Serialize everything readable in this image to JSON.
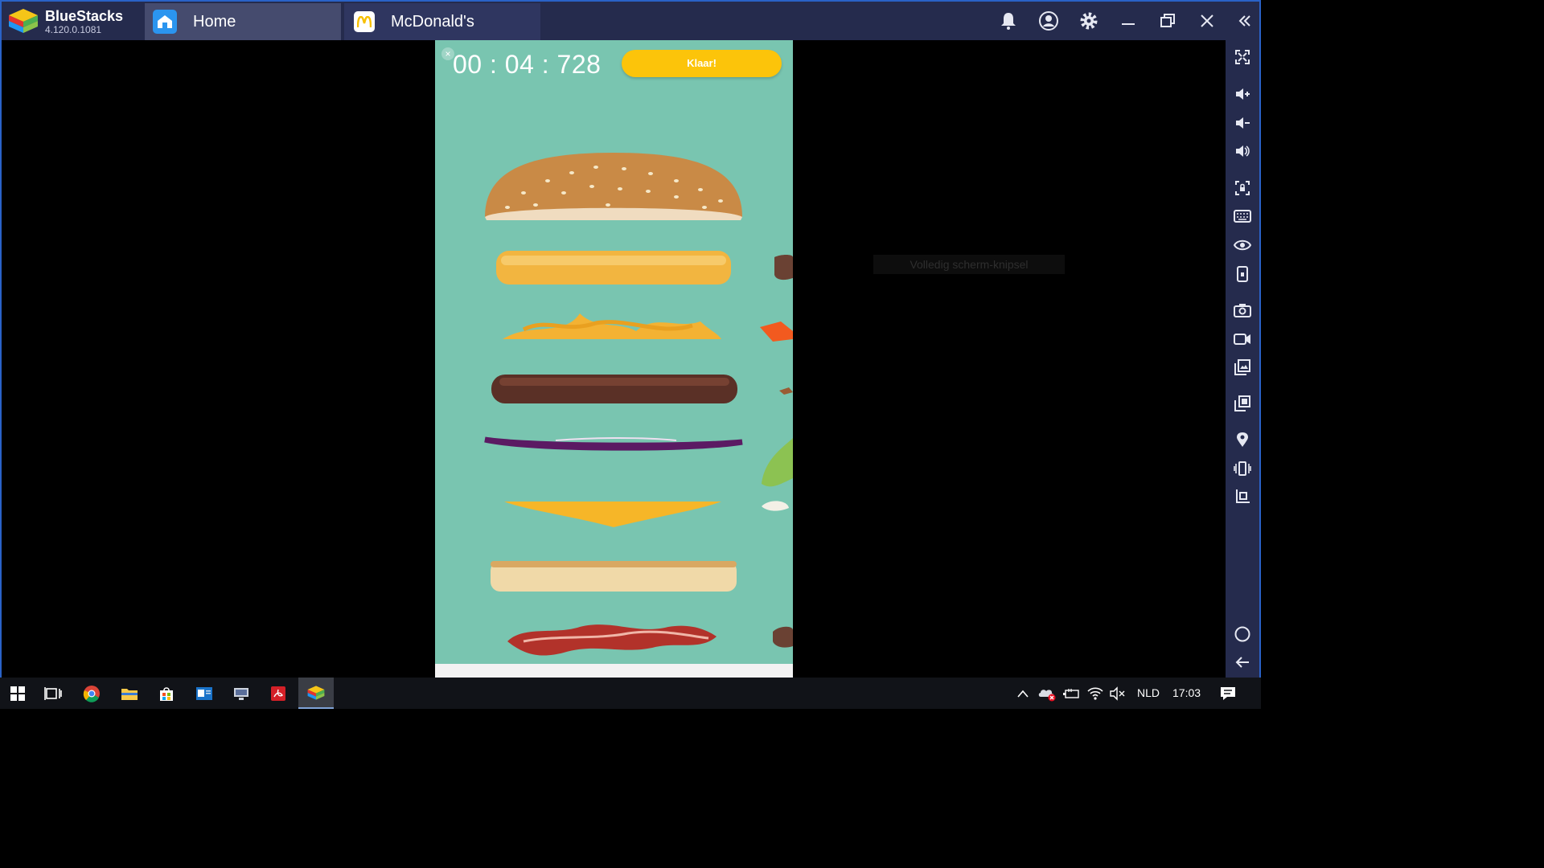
{
  "window": {
    "app_name": "BlueStacks",
    "app_version": "4.120.0.1081"
  },
  "tabs": [
    {
      "label": "Home",
      "icon": "home-icon"
    },
    {
      "label": "McDonald's",
      "icon": "mcdonalds-logo-icon"
    }
  ],
  "titlebar_buttons": [
    "bell-icon",
    "account-icon",
    "gear-icon",
    "minimize-icon",
    "restore-icon",
    "close-icon",
    "collapse-sidebar-icon"
  ],
  "sidebar_buttons": [
    "fullscreen-icon",
    "volume-up-icon",
    "volume-down-icon",
    "volume-mute-icon",
    "screen-lock-icon",
    "keyboard-icon",
    "eye-icon",
    "rotate-icon",
    "screenshot-icon",
    "record-icon",
    "media-manager-icon",
    "multi-instance-icon",
    "location-icon",
    "shake-icon",
    "resize-icon",
    "home-circle-icon",
    "back-arrow-icon"
  ],
  "game": {
    "close_glyph": "×",
    "timer": "00 : 04 : 728",
    "done_button": "Klaar!",
    "ingredients": [
      "bun-top",
      "hash-brown",
      "fries",
      "beef-patty",
      "red-onion",
      "cheese",
      "bun-bottom",
      "bacon"
    ]
  },
  "tooltip": {
    "text": "Volledig scherm-knipsel"
  },
  "taskbar": {
    "apps": [
      "windows-start-icon",
      "task-view-icon",
      "chrome-icon",
      "file-explorer-icon",
      "store-icon",
      "outlook-icon",
      "remote-desktop-icon",
      "acrobat-icon",
      "bluestacks-icon"
    ],
    "tray": {
      "language": "NLD",
      "time": "17:03"
    }
  },
  "colors": {
    "titlebar": "#252b4d",
    "game_background": "#79c5b0",
    "done_button": "#fcc40a",
    "frame_border": "#2a62c7"
  }
}
